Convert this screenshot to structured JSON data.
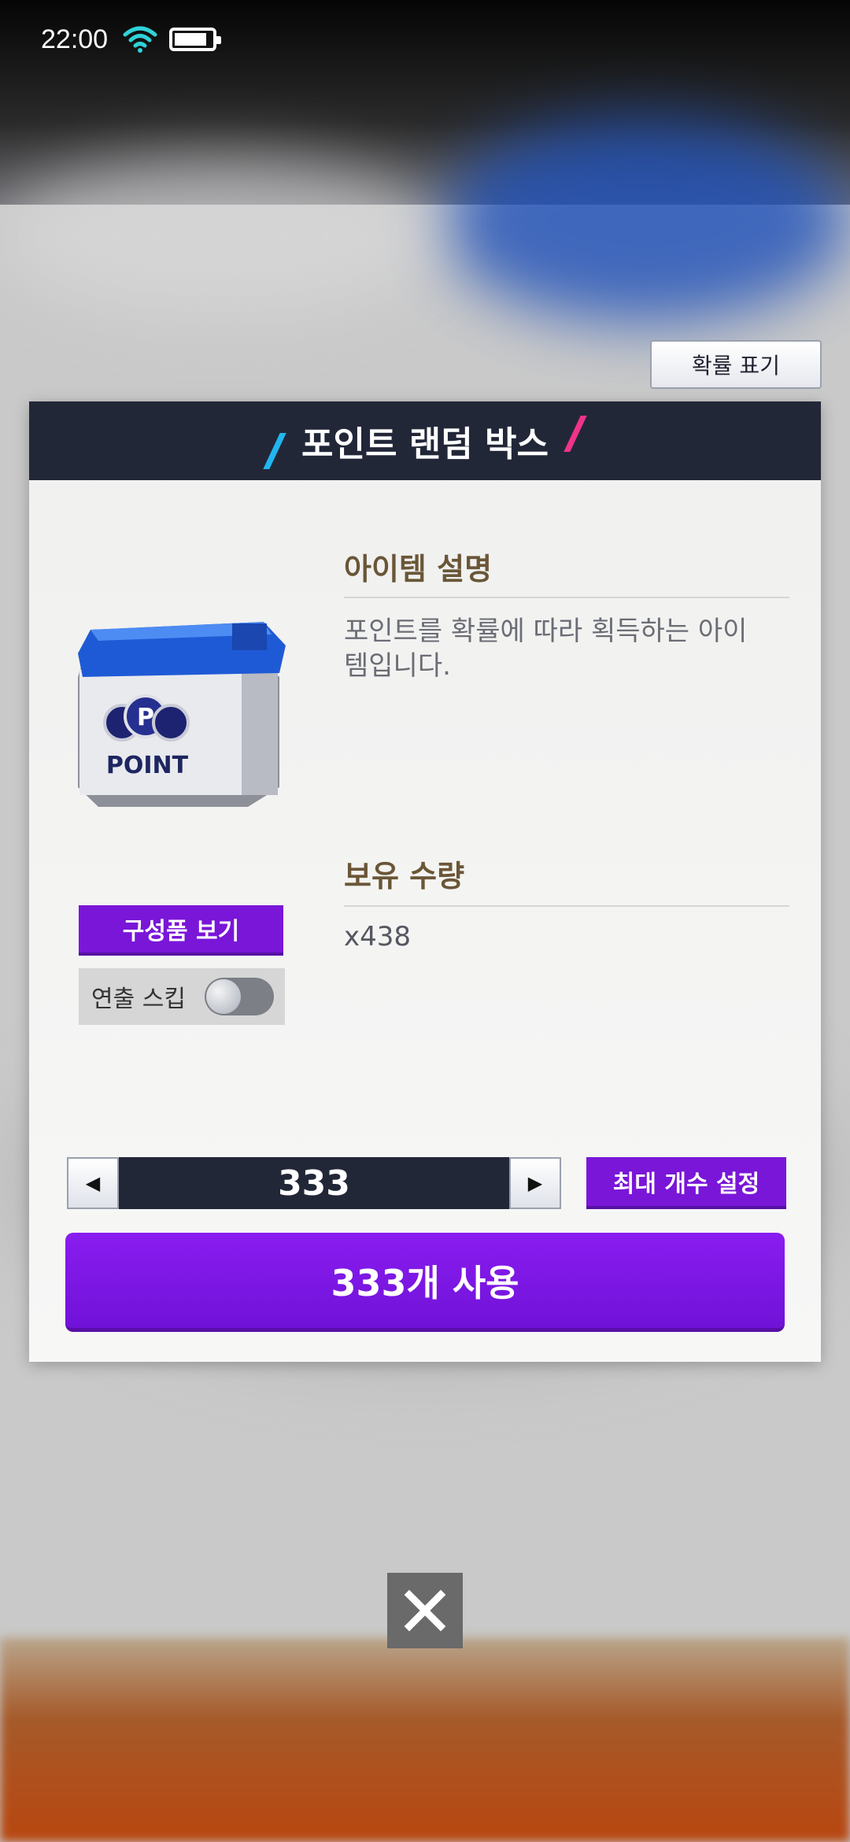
{
  "status_bar": {
    "time": "22:00"
  },
  "probability_button": {
    "label": "확률 표기"
  },
  "dialog": {
    "title": "포인트 랜덤 박스",
    "item_image_text": "POINT",
    "description_title": "아이템 설명",
    "description_text": "포인트를 확률에 따라 획득하는 아이템입니다.",
    "quantity_title": "보유 수량",
    "quantity_value": "x438",
    "components_button": "구성품 보기",
    "skip_label": "연출 스킵",
    "skip_enabled": false,
    "stepper_value": "333",
    "max_button": "최대 개수 설정",
    "use_button": "333개 사용"
  },
  "colors": {
    "header": "#222738",
    "accent_purple": "#7a16d8",
    "title_brown": "#6a5637"
  }
}
